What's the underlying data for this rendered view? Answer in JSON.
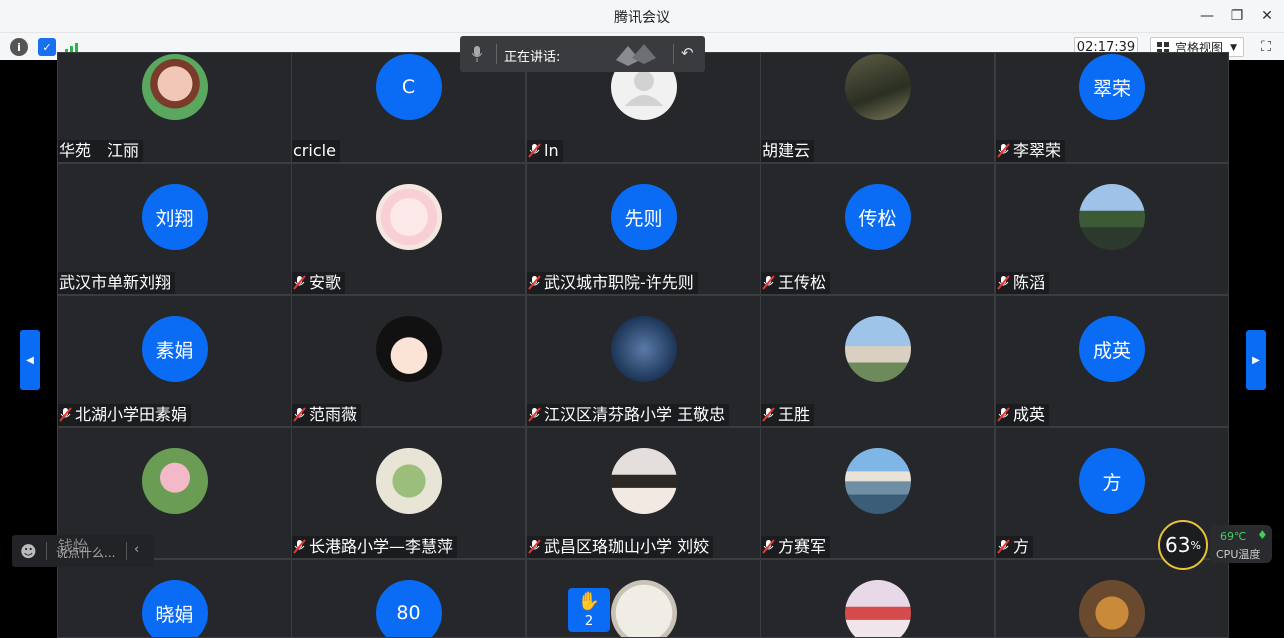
{
  "window": {
    "title": "腾讯会议"
  },
  "toolbar": {
    "timer": "02:17:39",
    "view_label": "宫格视图"
  },
  "speaking": {
    "label": "正在讲话:"
  },
  "tiles": [
    [
      {
        "name": "华苑　江丽",
        "mic": false,
        "avatar": "photo-pink"
      },
      {
        "name": "cricle",
        "mic": false,
        "avatar": "text",
        "text": "C"
      },
      {
        "name": "ln",
        "mic": true,
        "avatar": "default"
      },
      {
        "name": "胡建云",
        "mic": false,
        "avatar": "photo-tree"
      },
      {
        "name": "李翠荣",
        "mic": true,
        "avatar": "text",
        "text": "翠荣"
      }
    ],
    [
      {
        "name": "武汉市单新刘翔",
        "mic": false,
        "avatar": "text",
        "text": "刘翔"
      },
      {
        "name": "安歌",
        "mic": true,
        "avatar": "photo-anime"
      },
      {
        "name": "武汉城市职院-许先则",
        "mic": true,
        "avatar": "text",
        "text": "先则"
      },
      {
        "name": "王传松",
        "mic": true,
        "avatar": "text",
        "text": "传松"
      },
      {
        "name": "陈滔",
        "mic": true,
        "avatar": "photo-lake"
      }
    ],
    [
      {
        "name": "北湖小学田素娟",
        "mic": true,
        "avatar": "text",
        "text": "素娟"
      },
      {
        "name": "范雨薇",
        "mic": true,
        "avatar": "photo-cartoon"
      },
      {
        "name": "江汉区清芬路小学 王敬忠",
        "mic": true,
        "avatar": "photo-stars"
      },
      {
        "name": "王胜",
        "mic": true,
        "avatar": "photo-bike"
      },
      {
        "name": "成英",
        "mic": true,
        "avatar": "text",
        "text": "成英"
      }
    ],
    [
      {
        "name": "",
        "mic": false,
        "avatar": "photo-lotus"
      },
      {
        "name": "长港路小学—李慧萍",
        "mic": true,
        "avatar": "photo-plant"
      },
      {
        "name": "武昌区珞珈山小学 刘姣",
        "mic": true,
        "avatar": "photo-girl"
      },
      {
        "name": "方赛军",
        "mic": true,
        "avatar": "photo-mountain"
      },
      {
        "name": "方",
        "mic": true,
        "avatar": "text",
        "text": "方"
      }
    ],
    [
      {
        "name": "",
        "mic": false,
        "avatar": "text",
        "text": "晓娟"
      },
      {
        "name": "",
        "mic": false,
        "avatar": "text",
        "text": "80"
      },
      {
        "name": "",
        "mic": false,
        "avatar": "photo-sketch"
      },
      {
        "name": "",
        "mic": false,
        "avatar": "photo-couple"
      },
      {
        "name": "",
        "mic": false,
        "avatar": "photo-food"
      }
    ]
  ],
  "chat": {
    "placeholder": "说点什么...",
    "overlay_name": "钱怡"
  },
  "raise_hand": {
    "count": "2"
  },
  "cpu": {
    "percent": "63",
    "unit": "%",
    "temp": "69℃",
    "label": "CPU温度"
  }
}
